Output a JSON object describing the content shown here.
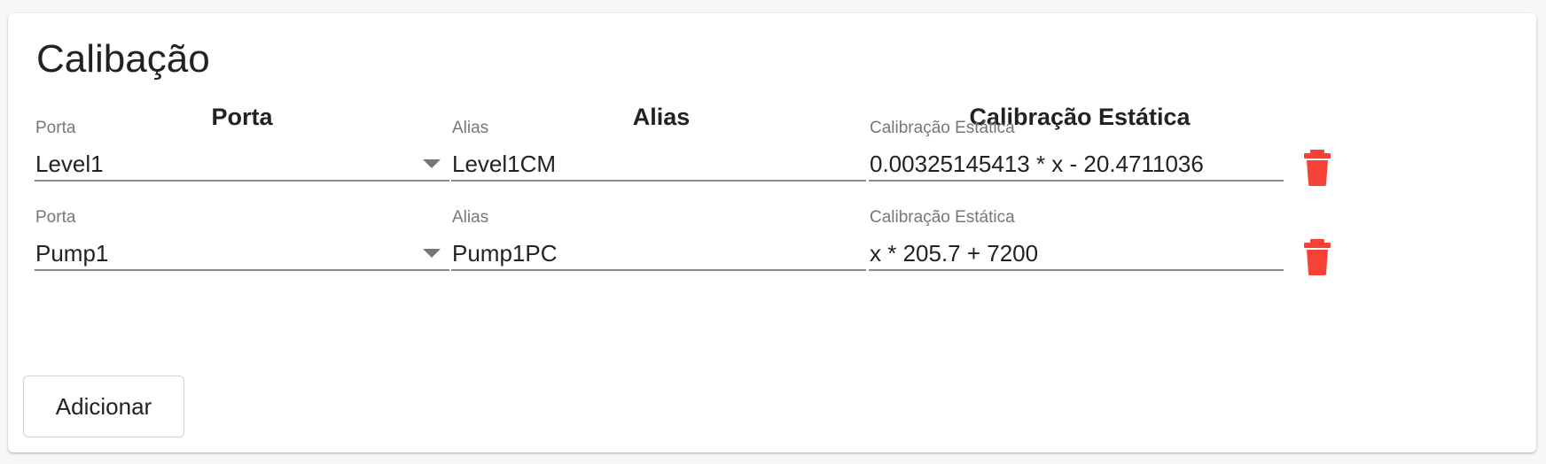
{
  "title": "Calibação",
  "columns": {
    "porta": "Porta",
    "alias": "Alias",
    "calibracao": "Calibração Estática"
  },
  "rows": [
    {
      "porta_label": "Porta",
      "porta_value": "Level1",
      "alias_label": "Alias",
      "alias_value": "Level1CM",
      "calibracao_label": "Calibração Estática",
      "calibracao_value": "0.00325145413 * x - 20.4711036"
    },
    {
      "porta_label": "Porta",
      "porta_value": "Pump1",
      "alias_label": "Alias",
      "alias_value": "Pump1PC",
      "calibracao_label": "Calibração Estática",
      "calibracao_value": "x * 205.7 + 7200"
    }
  ],
  "add_button_label": "Adicionar",
  "colors": {
    "delete_icon": "#f44336",
    "underline": "#8a8a8a",
    "label": "#777777",
    "text": "#222222"
  },
  "icons": {
    "delete": "trash-icon",
    "select": "dropdown-arrow-icon"
  }
}
